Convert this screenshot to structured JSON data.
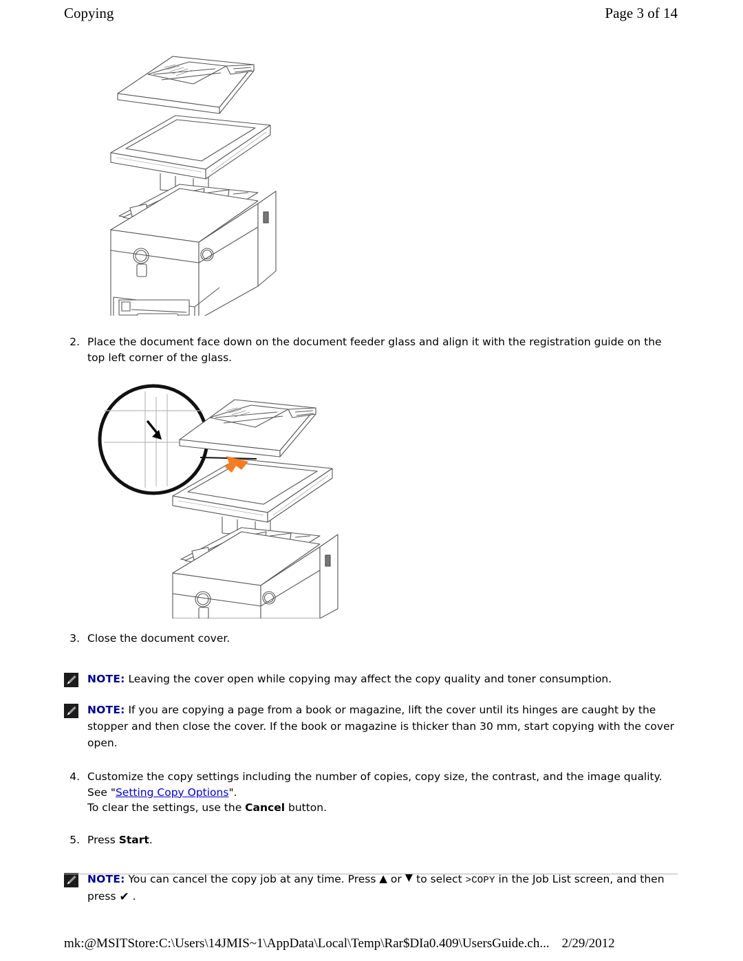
{
  "header": {
    "section_title": "Copying",
    "page_indicator": "Page 3 of 14"
  },
  "figures": [
    {
      "name": "printer-cover-open-illustration",
      "caption": "Line drawing of a multifunction laser printer with the document feeder cover raised open"
    },
    {
      "name": "printer-registration-guide-illustration",
      "caption": "Line drawing of the printer with a magnified circular callout of the registration guide at the top left corner of the document glass, and an orange arrow indicating the document placement corner"
    }
  ],
  "steps": [
    {
      "number": "2.",
      "lines": [
        "Place the document face down on the document feeder glass and align it with the registration guide on the top left corner of the glass."
      ]
    },
    {
      "number": "3.",
      "lines": [
        "Close the document cover."
      ]
    },
    {
      "number": "4.",
      "lead": "Customize the copy settings including the number of copies, copy size, the contrast, and the image quality. See \"",
      "link_text": "Setting Copy Options",
      "after_link": "\".",
      "line2_pre": "To clear the settings, use the ",
      "line2_bold": "Cancel",
      "line2_post": " button."
    },
    {
      "number": "5.",
      "pre": "Press ",
      "bold": "Start",
      "post": "."
    }
  ],
  "notes": [
    {
      "label": "NOTE:",
      "icon": "note-pencil-icon",
      "text": " Leaving the cover open while copying may affect the copy quality and toner consumption."
    },
    {
      "label": "NOTE:",
      "icon": "note-pencil-icon",
      "text": " If you are copying a page from a book or magazine, lift the cover until its hinges are caught by the stopper and then close the cover. If the book or magazine is thicker than 30 mm, start copying with the cover open."
    },
    {
      "label": "NOTE:",
      "icon": "note-pencil-icon",
      "seg1": " You can cancel the copy job at any time. Press ",
      "up_glyph": "▲",
      "seg2": " or ",
      "down_glyph": "▼",
      "seg3": " to select ",
      "mono_token": ">COPY",
      "seg4": " in the Job List screen, and then press ",
      "check_glyph": "✔",
      "seg5": " ."
    }
  ],
  "footer": {
    "path": "mk:@MSITStore:C:\\Users\\14JMIS~1\\AppData\\Local\\Temp\\Rar$DIa0.409\\UsersGuide.ch...",
    "date": "2/29/2012"
  },
  "colors": {
    "note_label": "#00008b",
    "link": "#0000cc",
    "orange_arrow": "#f57c20",
    "rule": "#b0b0b0",
    "line_art": "#555555"
  }
}
